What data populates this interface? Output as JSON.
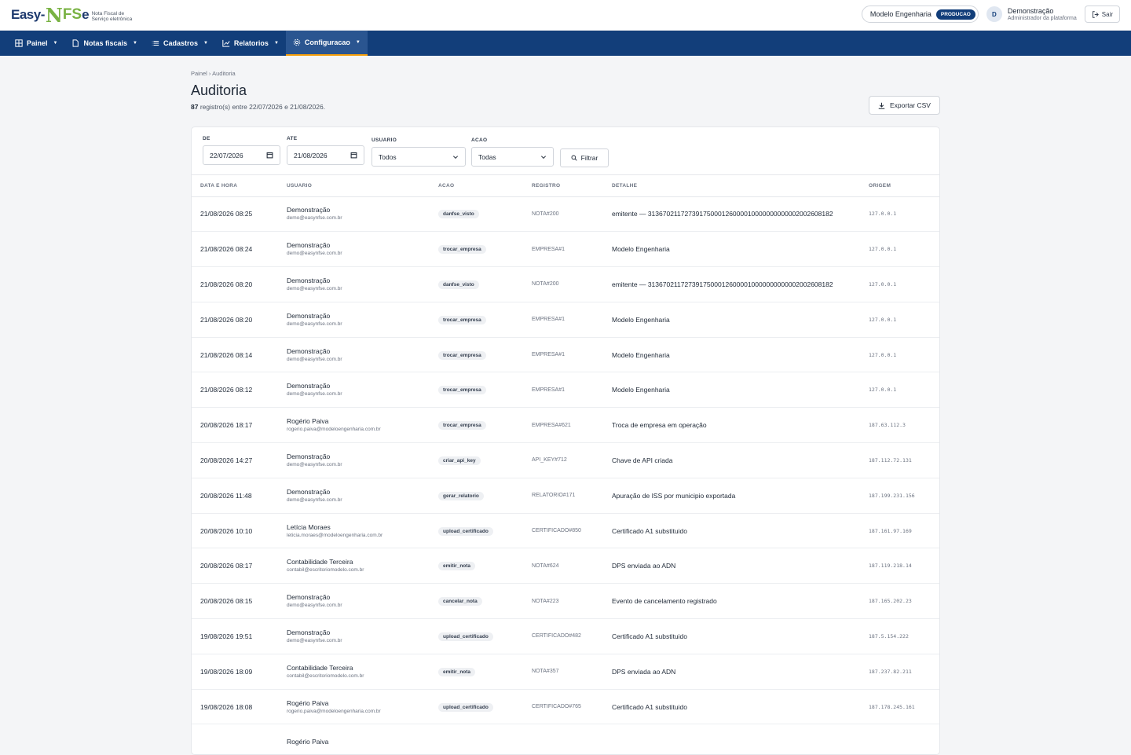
{
  "header": {
    "logo": {
      "easy": "Easy-",
      "n": "N",
      "fs": "FS",
      "e": "e",
      "subtitle": "Nota Fiscal de Serviço eletrônica"
    },
    "company": "Modelo Engenharia",
    "environment": "PRODUCAO",
    "user": {
      "initial": "D",
      "name": "Demonstração",
      "role": "Administrador da plataforma"
    },
    "logout_label": "Sair"
  },
  "nav": {
    "items": [
      {
        "label": "Painel",
        "icon": "grid-icon"
      },
      {
        "label": "Notas fiscais",
        "icon": "document-icon"
      },
      {
        "label": "Cadastros",
        "icon": "list-icon"
      },
      {
        "label": "Relatorios",
        "icon": "chart-icon"
      },
      {
        "label": "Configuracao",
        "icon": "gear-icon",
        "active": true
      }
    ]
  },
  "page": {
    "breadcrumb": "Painel › Auditoria",
    "title": "Auditoria",
    "summary_count": "87",
    "summary_text": " registro(s) entre 22/07/2026 e 21/08/2026.",
    "export_label": "Exportar CSV"
  },
  "filters": {
    "de": {
      "label": "DE",
      "value": "22/07/2026"
    },
    "ate": {
      "label": "ATE",
      "value": "21/08/2026"
    },
    "usuario": {
      "label": "USUARIO",
      "value": "Todos"
    },
    "acao": {
      "label": "ACAO",
      "value": "Todas"
    },
    "filter_label": "Filtrar"
  },
  "table": {
    "columns": [
      "DATA E HORA",
      "USUARIO",
      "ACAO",
      "REGISTRO",
      "DETALHE",
      "ORIGEM"
    ],
    "rows": [
      {
        "datetime": "21/08/2026 08:25",
        "user": "Demonstração",
        "email": "demo@easynfse.com.br",
        "action": "danfse_visto",
        "record": "NOTA#200",
        "detail": "emitente — 31367021172739175000126000010000000000002002608182",
        "origin": "127.0.0.1"
      },
      {
        "datetime": "21/08/2026 08:24",
        "user": "Demonstração",
        "email": "demo@easynfse.com.br",
        "action": "trocar_empresa",
        "record": "EMPRESA#1",
        "detail": "Modelo Engenharia",
        "origin": "127.0.0.1"
      },
      {
        "datetime": "21/08/2026 08:20",
        "user": "Demonstração",
        "email": "demo@easynfse.com.br",
        "action": "danfse_visto",
        "record": "NOTA#200",
        "detail": "emitente — 31367021172739175000126000010000000000002002608182",
        "origin": "127.0.0.1"
      },
      {
        "datetime": "21/08/2026 08:20",
        "user": "Demonstração",
        "email": "demo@easynfse.com.br",
        "action": "trocar_empresa",
        "record": "EMPRESA#1",
        "detail": "Modelo Engenharia",
        "origin": "127.0.0.1"
      },
      {
        "datetime": "21/08/2026 08:14",
        "user": "Demonstração",
        "email": "demo@easynfse.com.br",
        "action": "trocar_empresa",
        "record": "EMPRESA#1",
        "detail": "Modelo Engenharia",
        "origin": "127.0.0.1"
      },
      {
        "datetime": "21/08/2026 08:12",
        "user": "Demonstração",
        "email": "demo@easynfse.com.br",
        "action": "trocar_empresa",
        "record": "EMPRESA#1",
        "detail": "Modelo Engenharia",
        "origin": "127.0.0.1"
      },
      {
        "datetime": "20/08/2026 18:17",
        "user": "Rogério Paiva",
        "email": "rogerio.paiva@modeloengenharia.com.br",
        "action": "trocar_empresa",
        "record": "EMPRESA#621",
        "detail": "Troca de empresa em operação",
        "origin": "187.63.112.3"
      },
      {
        "datetime": "20/08/2026 14:27",
        "user": "Demonstração",
        "email": "demo@easynfse.com.br",
        "action": "criar_api_key",
        "record": "API_KEY#712",
        "detail": "Chave de API criada",
        "origin": "187.112.72.131"
      },
      {
        "datetime": "20/08/2026 11:48",
        "user": "Demonstração",
        "email": "demo@easynfse.com.br",
        "action": "gerar_relatorio",
        "record": "RELATORIO#171",
        "detail": "Apuração de ISS por municipio exportada",
        "origin": "187.199.231.156"
      },
      {
        "datetime": "20/08/2026 10:10",
        "user": "Letícia Moraes",
        "email": "leticia.moraes@modeloengenharia.com.br",
        "action": "upload_certificado",
        "record": "CERTIFICADO#850",
        "detail": "Certificado A1 substituido",
        "origin": "187.161.97.169"
      },
      {
        "datetime": "20/08/2026 08:17",
        "user": "Contabilidade Terceira",
        "email": "contabil@escritoriomodelo.com.br",
        "action": "emitir_nota",
        "record": "NOTA#624",
        "detail": "DPS enviada ao ADN",
        "origin": "187.119.218.14"
      },
      {
        "datetime": "20/08/2026 08:15",
        "user": "Demonstração",
        "email": "demo@easynfse.com.br",
        "action": "cancelar_nota",
        "record": "NOTA#223",
        "detail": "Evento de cancelamento registrado",
        "origin": "187.165.202.23"
      },
      {
        "datetime": "19/08/2026 19:51",
        "user": "Demonstração",
        "email": "demo@easynfse.com.br",
        "action": "upload_certificado",
        "record": "CERTIFICADO#482",
        "detail": "Certificado A1 substituido",
        "origin": "187.5.154.222"
      },
      {
        "datetime": "19/08/2026 18:09",
        "user": "Contabilidade Terceira",
        "email": "contabil@escritoriomodelo.com.br",
        "action": "emitir_nota",
        "record": "NOTA#357",
        "detail": "DPS enviada ao ADN",
        "origin": "187.237.82.211"
      },
      {
        "datetime": "19/08/2026 18:08",
        "user": "Rogério Paiva",
        "email": "rogerio.paiva@modeloengenharia.com.br",
        "action": "upload_certificado",
        "record": "CERTIFICADO#765",
        "detail": "Certificado A1 substituido",
        "origin": "187.178.245.161"
      },
      {
        "datetime": "",
        "user": "Rogério Paiva",
        "email": "",
        "action": "",
        "record": "",
        "detail": "",
        "origin": ""
      }
    ]
  }
}
